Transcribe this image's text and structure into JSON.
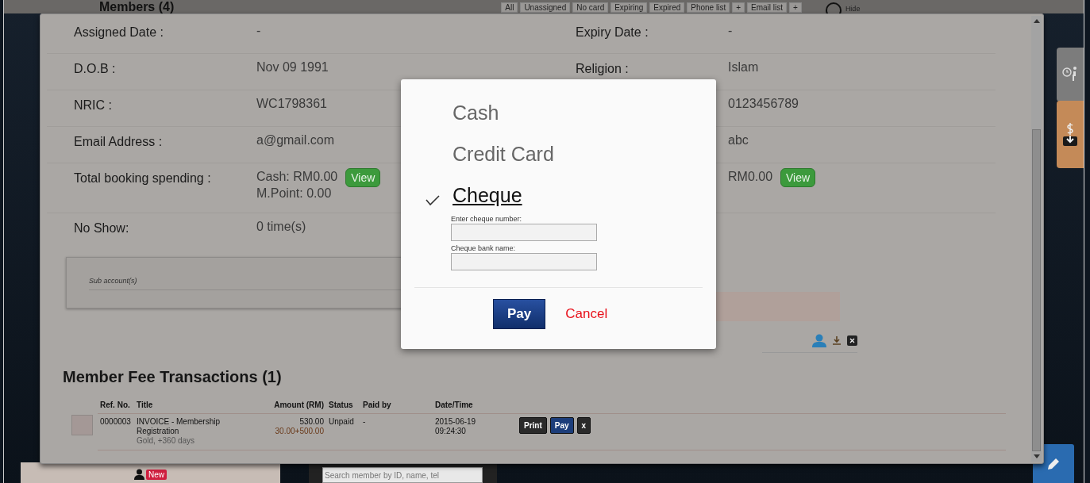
{
  "header": {
    "title": "Members (4)",
    "filters": [
      "All",
      "Unassigned",
      "No card",
      "Expiring",
      "Expired",
      "Phone list",
      "+",
      "Email list",
      "+"
    ],
    "hide_label": "Hide"
  },
  "details": [
    {
      "label": "Assigned Date :",
      "value": [
        "-"
      ],
      "label_2": "Expiry Date :",
      "value_2": [
        "-"
      ]
    },
    {
      "label": "D.O.B :",
      "value": [
        "Nov 09 1991"
      ],
      "label_2": "Religion :",
      "value_2": [
        "Islam"
      ]
    },
    {
      "label": "NRIC :",
      "value": [
        "WC1798361"
      ],
      "value_2": [
        "0123456789"
      ]
    },
    {
      "label": "Email Address :",
      "value": [
        "a@gmail.com"
      ],
      "value_2": [
        "abc"
      ]
    },
    {
      "label": "Total booking spending :",
      "value": [
        "Cash: RM0.00",
        "M.Point: 0.00"
      ],
      "button": "View",
      "value_2": [
        "RM0.00"
      ],
      "button_2": "View"
    },
    {
      "label": "No Show:",
      "value": [
        "0 time(s)"
      ]
    }
  ],
  "sub_accounts": {
    "title": "Sub account(s)"
  },
  "transactions": {
    "title": "Member Fee Transactions (1)",
    "columns": [
      "Ref. No.",
      "Title",
      "Amount (RM)",
      "Status",
      "Paid by",
      "Date/Time"
    ],
    "rows": [
      {
        "ref": "0000003",
        "title": [
          "INVOICE - Membership",
          "Registration"
        ],
        "note": "Gold, +360 days",
        "amount": "530.00",
        "amount_detail": "30.00+500.00",
        "status": "Unpaid",
        "paid_by": "-",
        "date": [
          "2015-06-19",
          "09:24:30"
        ],
        "actions": [
          "Print",
          "Pay",
          "x"
        ]
      }
    ]
  },
  "payment_dialog": {
    "options": [
      {
        "label": "Cash",
        "selected": false
      },
      {
        "label": "Credit Card",
        "selected": false
      },
      {
        "label": "Cheque",
        "selected": true
      }
    ],
    "fields": [
      {
        "label": "Enter cheque number:"
      },
      {
        "label": "Cheque bank name:"
      }
    ],
    "pay_button": "Pay",
    "cancel_button": "Cancel"
  },
  "footer": {
    "badge": "New",
    "search": {
      "placeholder": "Search member by ID, name, tel"
    }
  }
}
